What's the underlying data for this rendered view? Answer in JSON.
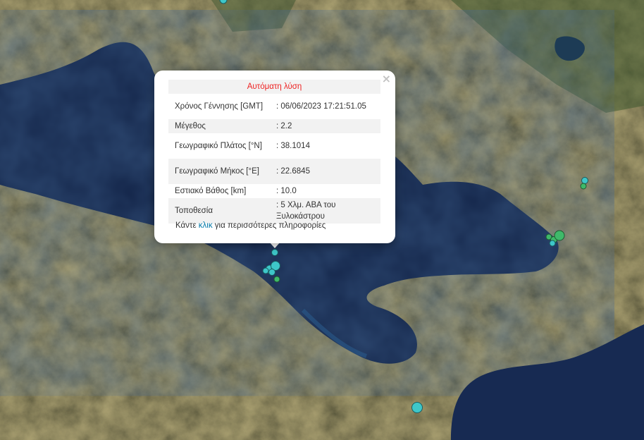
{
  "popup": {
    "title": "Αυτόματη λύση",
    "close": "×",
    "rows": [
      {
        "label": "Χρόνος Γέννησης [GMT]",
        "value": ": 06/06/2023 17:21:51.05"
      },
      {
        "label": "Μέγεθος",
        "value": ": 2.2"
      },
      {
        "label": "Γεωγραφικό Πλάτος [°N]",
        "value": ": 38.1014"
      },
      {
        "label": "Γεωγραφικό Μήκος [°E]",
        "value": ": 22.6845"
      },
      {
        "label": "Εστιακό Βάθος [km]",
        "value": ": 10.0"
      },
      {
        "label": "Τοποθεσία",
        "value": ": 5 Χλμ. ΑΒΑ του Ξυλοκάστρου"
      }
    ],
    "footer": {
      "before": "Κάντε ",
      "link": "κλικ",
      "after": " για περισσότερες πληροφορίες"
    }
  },
  "colors": {
    "sea": "#14264a",
    "land": "#4b4a2c",
    "marker_cyan": "#3ec7c9",
    "marker_green": "#3fb96a",
    "title_red": "#ee2222",
    "link_blue": "#0078a8"
  }
}
